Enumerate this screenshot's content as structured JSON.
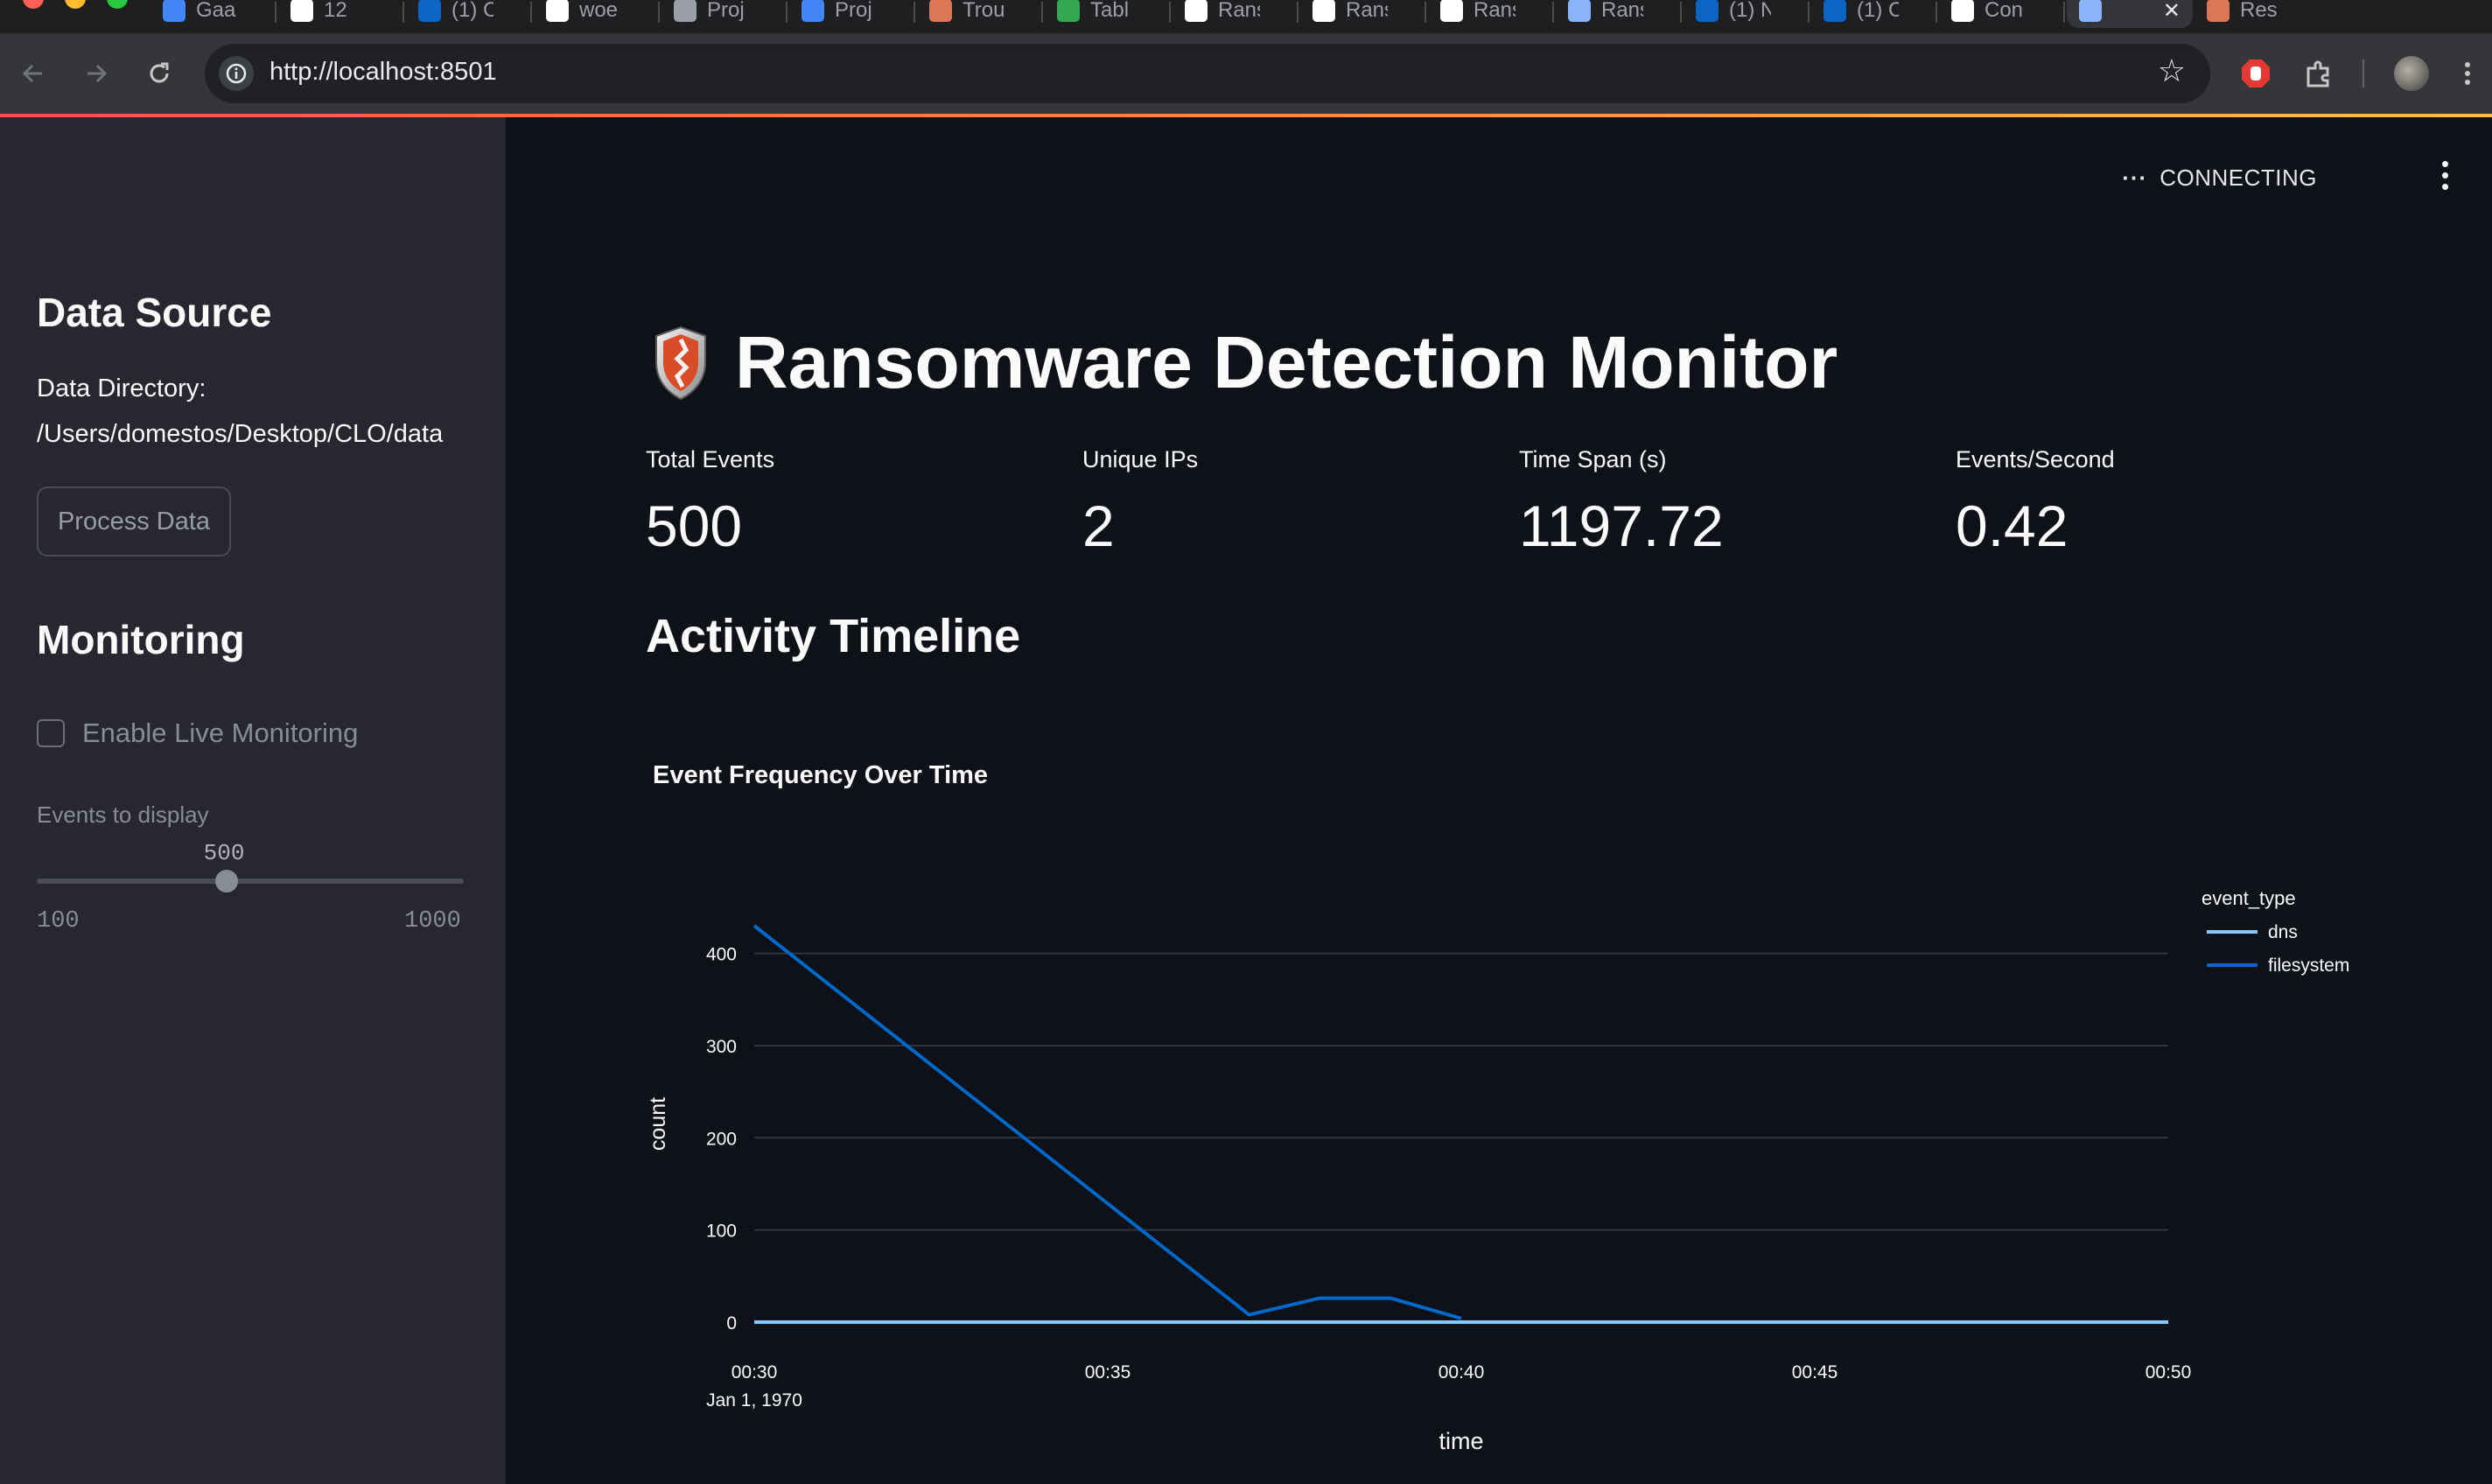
{
  "browser": {
    "url": "http://localhost:8501",
    "tabs": [
      {
        "label": "Gaa",
        "icon": "gmail-icon",
        "color": "#4285f4"
      },
      {
        "label": "12",
        "icon": "notion-icon",
        "color": "#ffffff"
      },
      {
        "label": "(1) C",
        "icon": "linkedin-icon",
        "color": "#0a66c2"
      },
      {
        "label": "woe",
        "icon": "github-icon",
        "color": "#ffffff"
      },
      {
        "label": "Proj",
        "icon": "profile-icon",
        "color": "#9aa0a6"
      },
      {
        "label": "Proj",
        "icon": "docs-icon",
        "color": "#4285f4"
      },
      {
        "label": "Trou",
        "icon": "claude-icon",
        "color": "#d97757"
      },
      {
        "label": "Tabl",
        "icon": "chrome-icon",
        "color": "#34a853"
      },
      {
        "label": "Rans",
        "icon": "page-icon",
        "color": "#ffffff"
      },
      {
        "label": "Rans",
        "icon": "page-icon",
        "color": "#ffffff"
      },
      {
        "label": "Rans",
        "icon": "page-icon",
        "color": "#ffffff"
      },
      {
        "label": "Rans",
        "icon": "shield-icon",
        "color": "#8ab4f8"
      },
      {
        "label": "(1) N",
        "icon": "linkedin-icon",
        "color": "#0a66c2"
      },
      {
        "label": "(1) C",
        "icon": "linkedin-icon",
        "color": "#0a66c2"
      },
      {
        "label": "Con",
        "icon": "page-icon",
        "color": "#ffffff"
      },
      {
        "label": "",
        "icon": "shield-icon",
        "color": "#8ab4f8",
        "active": true
      },
      {
        "label": "Res",
        "icon": "claude-icon",
        "color": "#d97757"
      }
    ]
  },
  "sidebar": {
    "data_source_heading": "Data Source",
    "data_dir_label": "Data Directory:",
    "data_dir_path": "/Users/domestos/Desktop/CLO/data",
    "process_button": "Process Data",
    "monitoring_heading": "Monitoring",
    "live_monitoring_label": "Enable Live Monitoring",
    "live_monitoring_checked": false,
    "slider": {
      "label": "Events to display",
      "value": "500",
      "min": "100",
      "max": "1000",
      "fraction": 0.444
    }
  },
  "main": {
    "status": "CONNECTING",
    "title": "Ransomware Detection Monitor",
    "title_icon": "shield-icon",
    "metrics": [
      {
        "label": "Total Events",
        "value": "500"
      },
      {
        "label": "Unique IPs",
        "value": "2"
      },
      {
        "label": "Time Span (s)",
        "value": "1197.72"
      },
      {
        "label": "Events/Second",
        "value": "0.42"
      }
    ],
    "section_heading": "Activity Timeline"
  },
  "chart_data": {
    "type": "line",
    "title": "Event Frequency Over Time",
    "xlabel": "time",
    "ylabel": "count",
    "x_ticks": [
      "00:30",
      "00:35",
      "00:40",
      "00:45",
      "00:50"
    ],
    "x_tick_sublabel": "Jan 1, 1970",
    "y_ticks": [
      0,
      100,
      200,
      300,
      400
    ],
    "xlim_minutes": [
      30,
      50
    ],
    "ylim": [
      0,
      430
    ],
    "legend_title": "event_type",
    "legend_position": "top-right",
    "grid": true,
    "series": [
      {
        "name": "dns",
        "color": "#83c9ff",
        "points": [
          [
            30,
            0
          ],
          [
            50,
            0
          ]
        ]
      },
      {
        "name": "filesystem",
        "color": "#0068c9",
        "points": [
          [
            30,
            430
          ],
          [
            37,
            8
          ],
          [
            38,
            26
          ],
          [
            39,
            26
          ],
          [
            40,
            4
          ]
        ]
      }
    ]
  },
  "colors": {
    "background": "#0e1117",
    "sidebar": "#262730",
    "accent_gradient_start": "#ff4b4b",
    "accent_gradient_end": "#ffbd45"
  }
}
